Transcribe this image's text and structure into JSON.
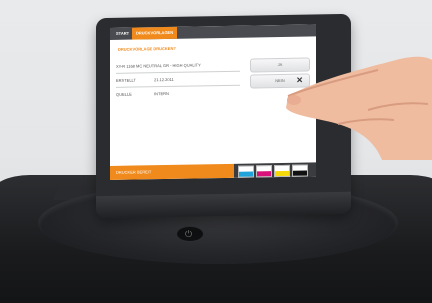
{
  "header": {
    "tabs": [
      {
        "label": "START"
      },
      {
        "label": "DRUCKVORLAGEN"
      }
    ]
  },
  "main": {
    "headline": "DRUCKVORLAGE DRUCKEN?",
    "rows": [
      {
        "label": "XY-R 1168 MC NEUTRAL GR - HIGH QUALITY"
      },
      {
        "label": "ERSTELLT",
        "value": "21.12.2011"
      },
      {
        "label": "QUELLE",
        "value": "INTERN"
      }
    ],
    "buttons": {
      "yes": "JA",
      "no": "NEIN"
    }
  },
  "footer": {
    "status": "DRUCKER BEREIT",
    "ink_levels": [
      {
        "color": "cyan",
        "hex": "#1fa3d8",
        "level": 0.55
      },
      {
        "color": "magenta",
        "hex": "#d8127a",
        "level": 0.55
      },
      {
        "color": "yellow",
        "hex": "#f5d90a",
        "level": 0.55
      },
      {
        "color": "black",
        "hex": "#111111",
        "level": 0.55
      }
    ]
  },
  "colors": {
    "accent": "#f08a1c",
    "nav_bg": "#4a4b50",
    "device_body": "#1f2023"
  },
  "icons": {
    "no_button_icon": "close-icon",
    "device_logo": "power-icon"
  }
}
